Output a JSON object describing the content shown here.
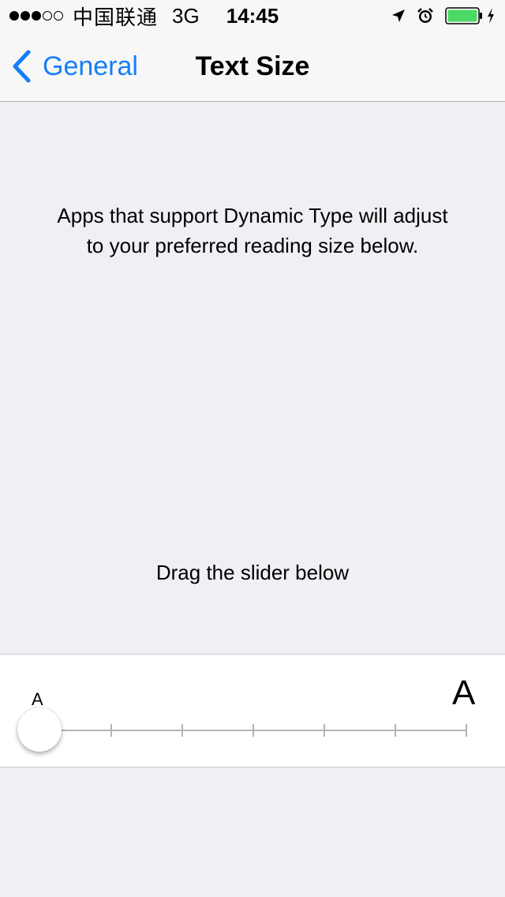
{
  "status_bar": {
    "carrier": "中国联通",
    "network": "3G",
    "time": "14:45",
    "signal_bars_filled": 3,
    "signal_bars_total": 5,
    "battery_color": "#4cd964",
    "icons": [
      "location-arrow-icon",
      "alarm-clock-icon",
      "battery-icon",
      "charging-bolt-icon"
    ]
  },
  "nav": {
    "back_label": "General",
    "title": "Text Size",
    "accent_color": "#147efb"
  },
  "content": {
    "description": "Apps that support Dynamic Type will adjust to your preferred reading size below.",
    "drag_hint": "Drag the slider below"
  },
  "slider": {
    "small_label": "A",
    "large_label": "A",
    "steps": 7,
    "selected_step": 0
  }
}
